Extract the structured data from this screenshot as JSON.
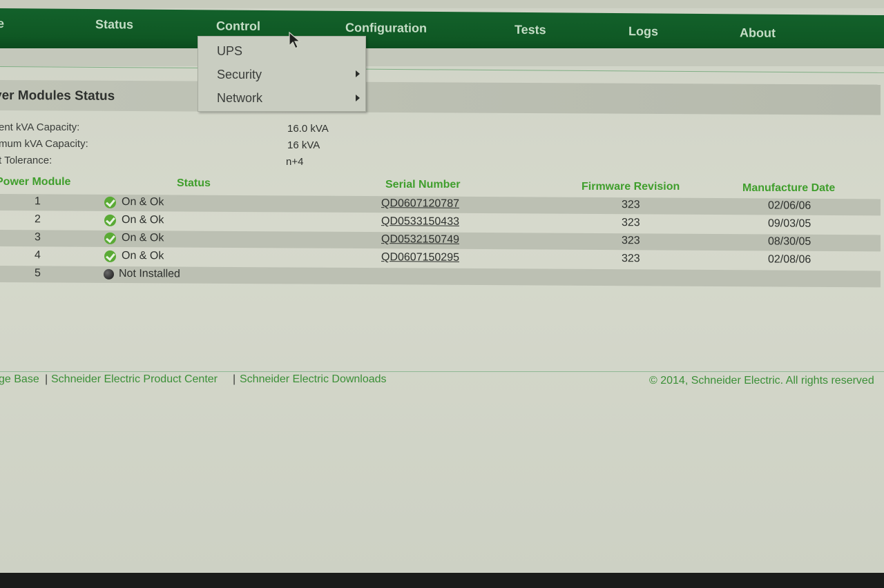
{
  "nav": {
    "items": [
      {
        "label": "e",
        "x": -4
      },
      {
        "label": "Status"
      },
      {
        "label": "Control"
      },
      {
        "label": "Configuration"
      },
      {
        "label": "Tests"
      },
      {
        "label": "Logs"
      },
      {
        "label": "About"
      }
    ]
  },
  "dropdown": {
    "items": [
      "UPS",
      "Security",
      "Network"
    ]
  },
  "section": {
    "title": "ver Modules Status"
  },
  "info": {
    "current_kva_label": "ent kVA Capacity:",
    "current_kva_value": "16.0 kVA",
    "max_kva_label": "mum kVA Capacity:",
    "max_kva_value": "16 kVA",
    "tolerance_label": "t Tolerance:",
    "tolerance_value": "n+4"
  },
  "table": {
    "headers": {
      "module": "Power Module",
      "status": "Status",
      "serial": "Serial Number",
      "firmware": "Firmware Revision",
      "date": "Manufacture Date"
    },
    "rows": [
      {
        "module": "1",
        "status": "On & Ok",
        "serial": "QD0607120787",
        "firmware": "323",
        "date": "02/06/06"
      },
      {
        "module": "2",
        "status": "On & Ok",
        "serial": "QD0533150433",
        "firmware": "323",
        "date": "09/03/05"
      },
      {
        "module": "3",
        "status": "On & Ok",
        "serial": "QD0532150749",
        "firmware": "323",
        "date": "08/30/05"
      },
      {
        "module": "4",
        "status": "On & Ok",
        "serial": "QD0607150295",
        "firmware": "323",
        "date": "02/08/06"
      },
      {
        "module": "5",
        "status": "Not Installed",
        "serial": "",
        "firmware": "",
        "date": ""
      }
    ]
  },
  "footer": {
    "link1": "ge Base",
    "link2": "Schneider Electric Product Center",
    "link3": "Schneider Electric Downloads",
    "separator": "|",
    "copyright": "© 2014, Schneider Electric. All rights reserved"
  },
  "colors": {
    "nav_green": "#13612b",
    "header_green": "#3f9e2c",
    "ok_green": "#5aaa35"
  }
}
